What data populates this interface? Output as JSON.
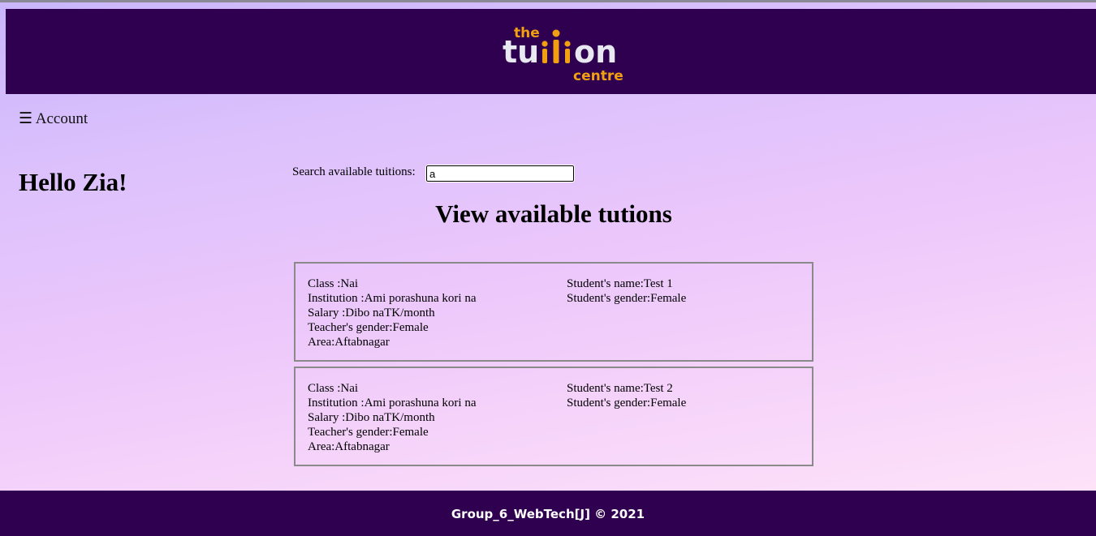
{
  "header": {
    "logo": {
      "word_top": "the",
      "word_main_left": "tu",
      "word_main_right": "on",
      "word_sub": "centre",
      "colors": {
        "orange": "#f0a010",
        "white": "#e8e8f0"
      }
    },
    "background_color": "#300050"
  },
  "nav": {
    "menu_label": "☰ Account"
  },
  "greeting": "Hello Zia!",
  "search": {
    "label": "Search available tuitions:",
    "value": "a"
  },
  "section_title": "View available tutions",
  "tuitions": [
    {
      "class_text": "Class :Nai",
      "institution_text": "Institution :Ami porashuna kori na",
      "salary_text": "Salary :Dibo naTK/month",
      "teacher_gender_text": "Teacher's gender:Female",
      "area_text": "Area:Aftabnagar",
      "student_name_text": "Student's name:Test 1",
      "student_gender_text": "Student's gender:Female"
    },
    {
      "class_text": "Class :Nai",
      "institution_text": "Institution :Ami porashuna kori na",
      "salary_text": "Salary :Dibo naTK/month",
      "teacher_gender_text": "Teacher's gender:Female",
      "area_text": "Area:Aftabnagar",
      "student_name_text": "Student's name:Test 2",
      "student_gender_text": "Student's gender:Female"
    }
  ],
  "footer": {
    "text": "Group_6_WebTech[J] © 2021"
  }
}
